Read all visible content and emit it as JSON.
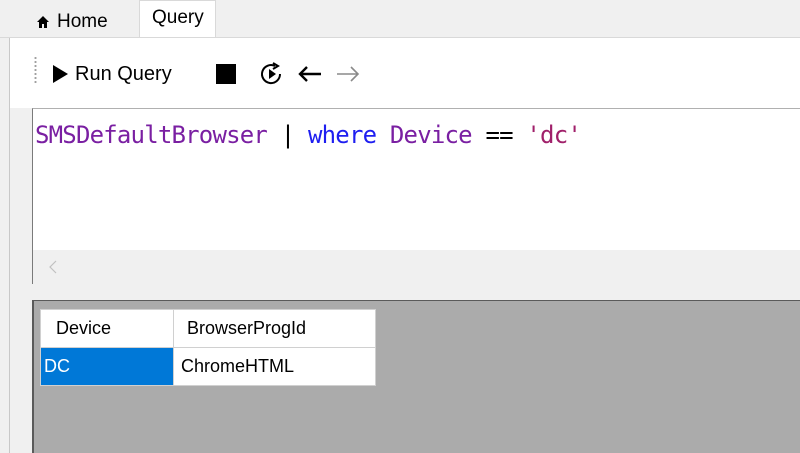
{
  "tabs": [
    {
      "label": "Home",
      "icon": "home-icon",
      "active": false
    },
    {
      "label": "Query",
      "active": true
    }
  ],
  "toolbar": {
    "run_label": "Run Query",
    "buttons": [
      "run-icon",
      "stop-icon",
      "step-icon",
      "back-arrow-icon",
      "forward-arrow-icon"
    ]
  },
  "editor": {
    "tokens": [
      {
        "text": "SMSDefaultBrowser",
        "color": "#7a1fa2"
      },
      {
        "text": " | ",
        "color": "#000000"
      },
      {
        "text": "where",
        "color": "#1e1ef0"
      },
      {
        "text": " Device",
        "color": "#7a1fa2"
      },
      {
        "text": " == ",
        "color": "#000000"
      },
      {
        "text": "'dc'",
        "color": "#a0206a"
      }
    ]
  },
  "results": {
    "columns": [
      "Device",
      "BrowserProgId"
    ],
    "rows": [
      [
        "DC",
        "ChromeHTML"
      ]
    ],
    "selected_color": "#0078d7"
  }
}
